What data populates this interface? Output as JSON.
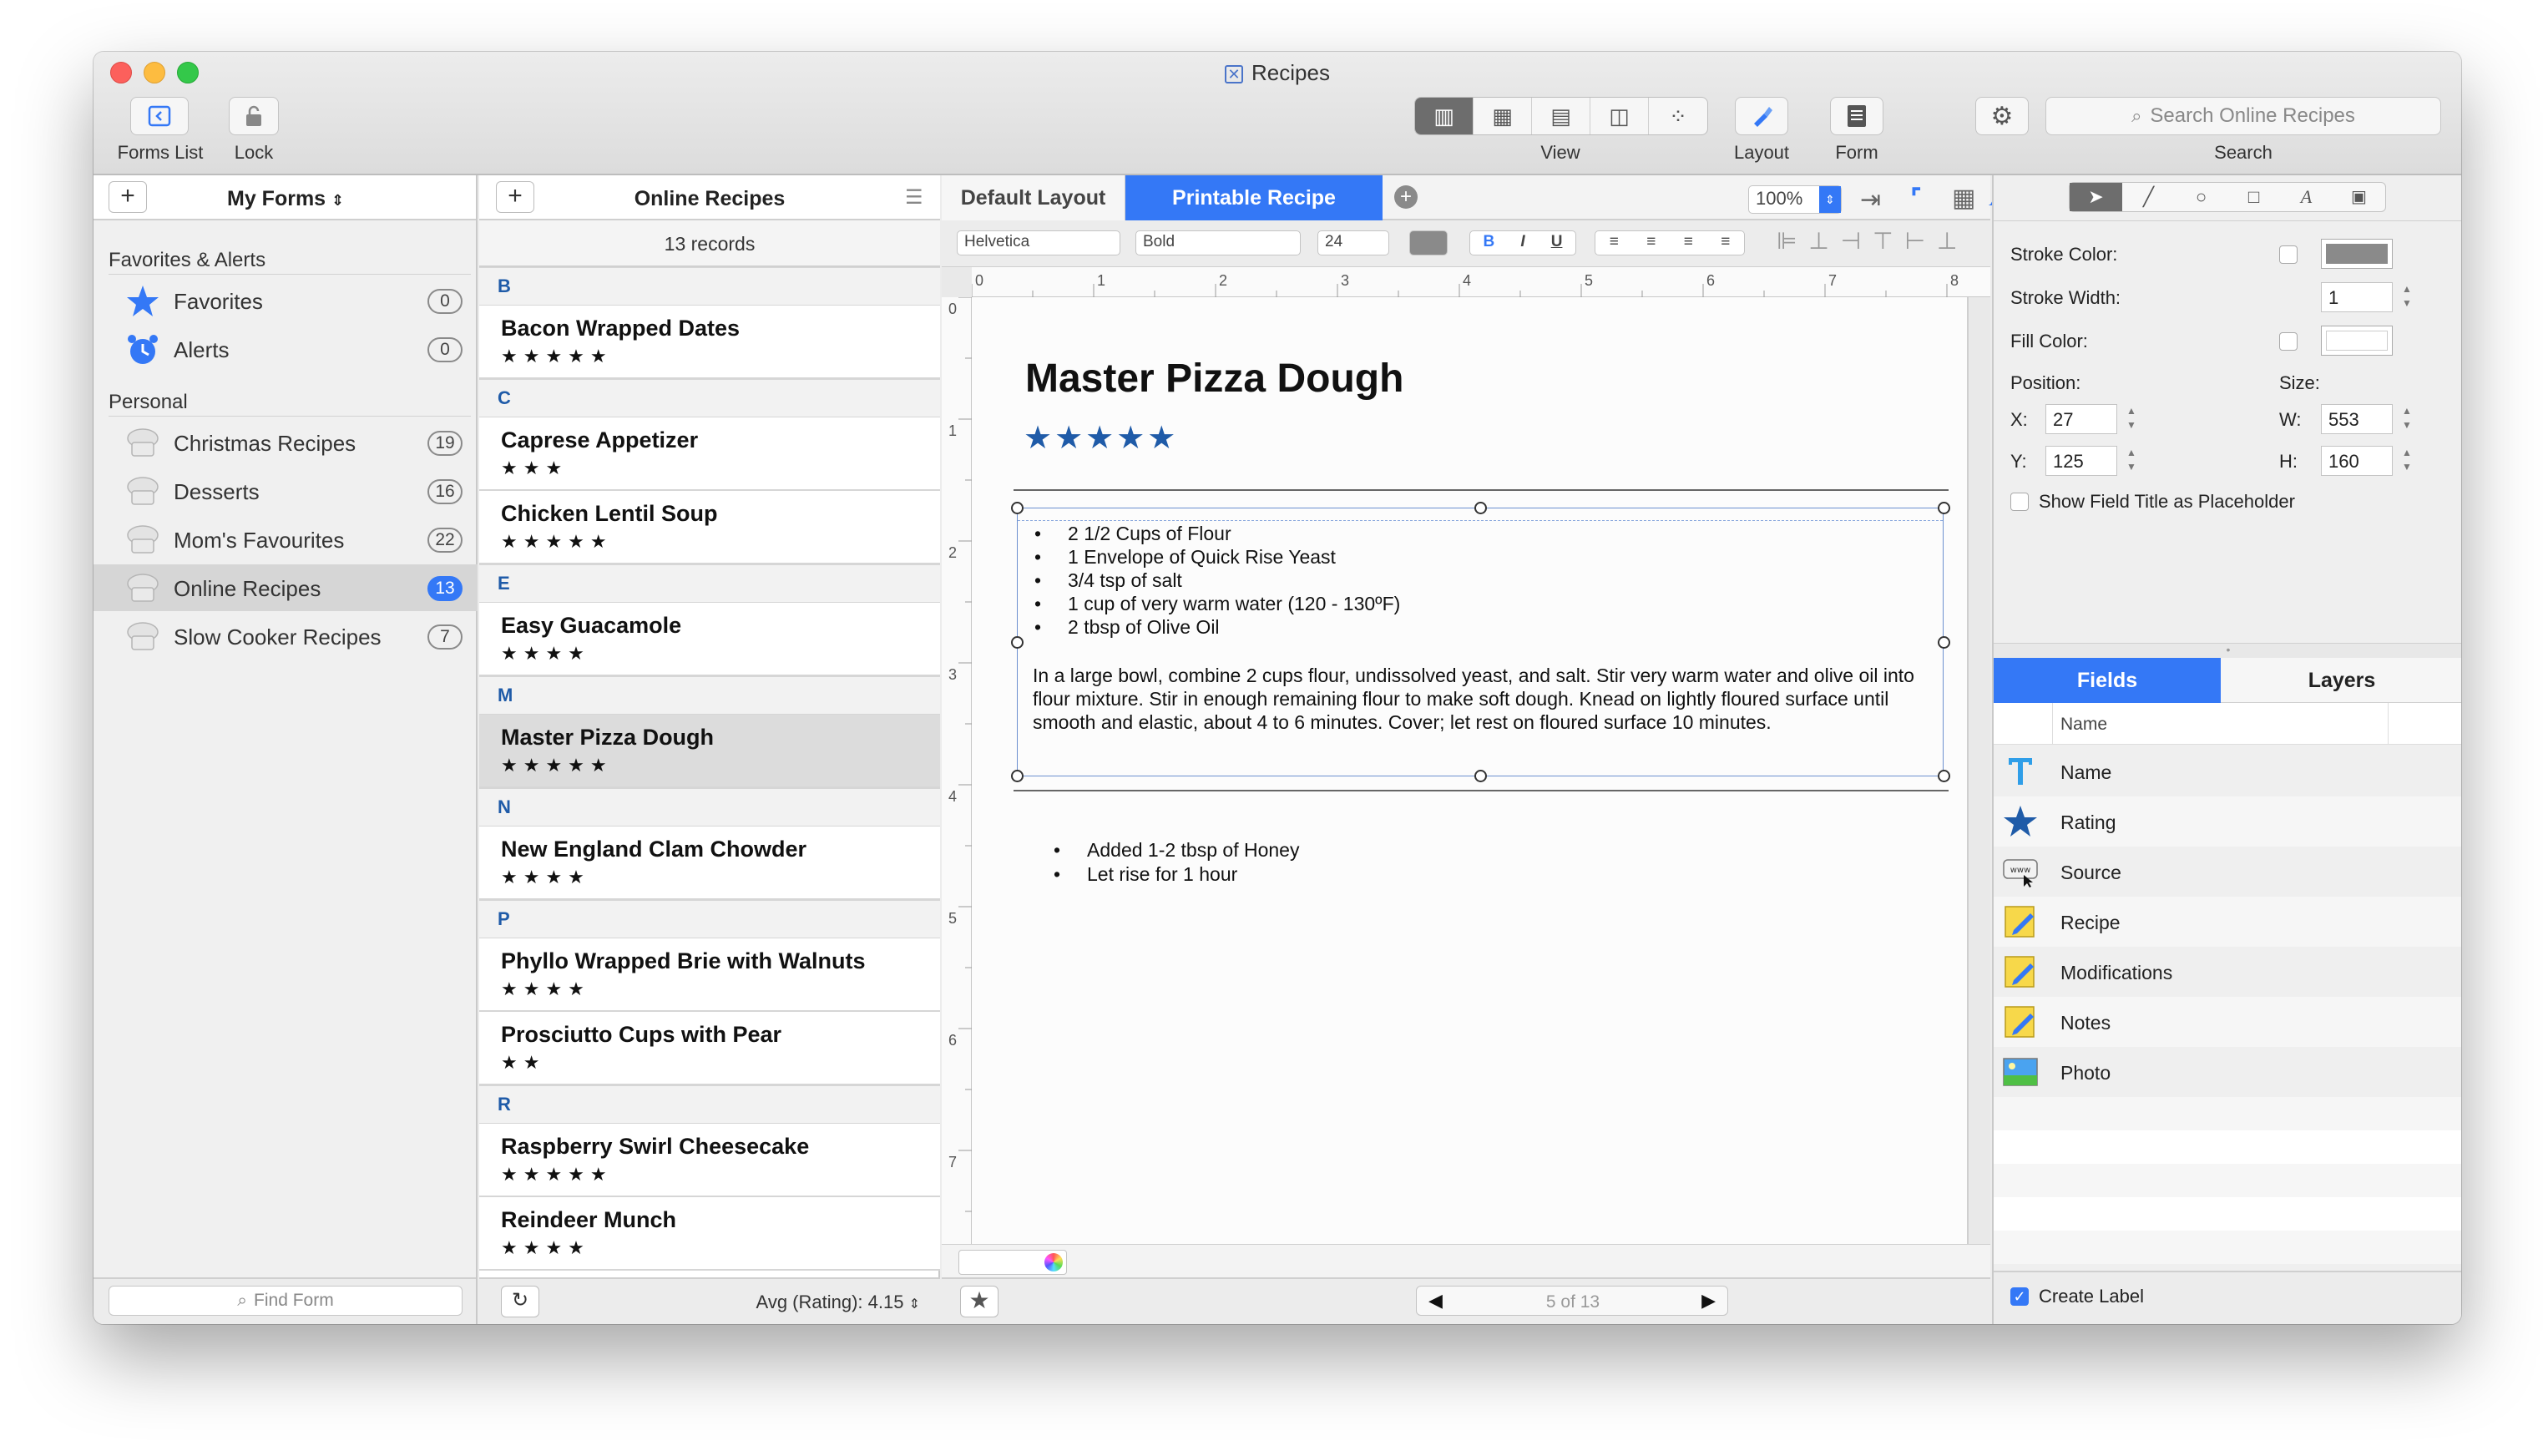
{
  "window": {
    "title": "Recipes"
  },
  "toolbar": {
    "forms_list_label": "Forms List",
    "lock_label": "Lock",
    "view_label": "View",
    "layout_label": "Layout",
    "form_label": "Form",
    "search_label": "Search",
    "search_placeholder": "Search Online Recipes"
  },
  "sidebar": {
    "header": "My Forms",
    "favorites_section": "Favorites & Alerts",
    "favorites": [
      {
        "label": "Favorites",
        "count": "0"
      },
      {
        "label": "Alerts",
        "count": "0"
      }
    ],
    "personal_section": "Personal",
    "forms": [
      {
        "label": "Christmas Recipes",
        "count": "19"
      },
      {
        "label": "Desserts",
        "count": "16"
      },
      {
        "label": "Mom's Favourites",
        "count": "22"
      },
      {
        "label": "Online Recipes",
        "count": "13",
        "selected": true
      },
      {
        "label": "Slow Cooker Recipes",
        "count": "7"
      }
    ],
    "find_placeholder": "Find Form"
  },
  "list": {
    "header": "Online Recipes",
    "count": "13 records",
    "letters": [
      "B",
      "C",
      "E",
      "M",
      "N",
      "P",
      "R"
    ],
    "records": [
      {
        "name": "Bacon Wrapped Dates",
        "stars": "★★★★★"
      },
      {
        "name": "Caprese Appetizer",
        "stars": "★★★"
      },
      {
        "name": "Chicken Lentil Soup",
        "stars": "★★★★★"
      },
      {
        "name": "Easy Guacamole",
        "stars": "★★★★"
      },
      {
        "name": "Master Pizza Dough",
        "stars": "★★★★★"
      },
      {
        "name": "New England Clam Chowder",
        "stars": "★★★★"
      },
      {
        "name": "Phyllo Wrapped Brie with Walnuts",
        "stars": "★★★★"
      },
      {
        "name": "Prosciutto Cups with Pear",
        "stars": "★★"
      },
      {
        "name": "Raspberry Swirl Cheesecake",
        "stars": "★★★★★"
      },
      {
        "name": "Reindeer Munch",
        "stars": "★★★★"
      }
    ],
    "footer_avg": "Avg (Rating): 4.15"
  },
  "editor": {
    "tabs": [
      {
        "label": "Default Layout"
      },
      {
        "label": "Printable Recipe"
      }
    ],
    "zoom": "100%",
    "font_name": "Helvetica",
    "font_style": "Bold",
    "font_size": "24",
    "ruler_h": [
      "0",
      "1",
      "2",
      "3",
      "4",
      "5",
      "6",
      "7",
      "8"
    ],
    "ruler_v": [
      "0",
      "1",
      "2",
      "3",
      "4",
      "5",
      "6",
      "7"
    ],
    "recipe_title": "Master Pizza Dough",
    "recipe_stars": "★★★★★",
    "ingredients": [
      "2 1/2 Cups of Flour",
      "1 Envelope of Quick Rise Yeast",
      "3/4 tsp of salt",
      "1 cup of very warm water (120 - 130ºF)",
      "2 tbsp of Olive Oil"
    ],
    "directions": "In a large bowl, combine 2 cups flour, undissolved yeast, and salt. Stir very warm water and olive oil into flour mixture. Stir in enough remaining flour to make soft dough. Knead on lightly floured surface until smooth and elastic, about 4 to 6 minutes. Cover; let rest on floured surface 10 minutes.",
    "modifications": [
      "Added 1-2 tbsp of Honey",
      "Let rise for 1 hour"
    ],
    "pager": "5 of 13"
  },
  "inspector": {
    "stroke_color_label": "Stroke Color:",
    "stroke_width_label": "Stroke Width:",
    "stroke_width": "1",
    "fill_color_label": "Fill Color:",
    "position_label": "Position:",
    "size_label": "Size:",
    "x_label": "X:",
    "x": "27",
    "y_label": "Y:",
    "y": "125",
    "w_label": "W:",
    "w": "553",
    "h_label": "H:",
    "h": "160",
    "placeholder_option": "Show Field Title as Placeholder",
    "tabs": [
      {
        "label": "Fields"
      },
      {
        "label": "Layers"
      }
    ],
    "column_header": "Name",
    "fields": [
      {
        "label": "Name",
        "icon": "text-field-icon"
      },
      {
        "label": "Rating",
        "icon": "star-icon"
      },
      {
        "label": "Source",
        "icon": "web-icon"
      },
      {
        "label": "Recipe",
        "icon": "note-icon"
      },
      {
        "label": "Modifications",
        "icon": "note-icon"
      },
      {
        "label": "Notes",
        "icon": "note-icon"
      },
      {
        "label": "Photo",
        "icon": "photo-icon"
      }
    ],
    "create_label": "Create Label"
  },
  "colors": {
    "accent": "#3478f6",
    "star": "#1f5ba8"
  }
}
